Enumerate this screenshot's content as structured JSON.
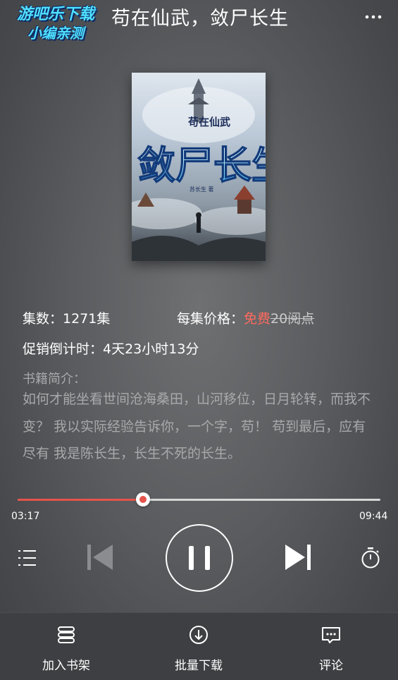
{
  "watermark": {
    "line1": "游吧乐下载",
    "line2": "小编亲测"
  },
  "header": {
    "title": "苟在仙武，敛尸长生"
  },
  "cover": {
    "small_title": "苟在仙武",
    "big_title": "敛尸长生",
    "author": "苏长生 著"
  },
  "info": {
    "episodes_label": "集数：1271集",
    "price_label": "每集价格：",
    "price_free": "免费",
    "price_old": "20阅点",
    "countdown": "促销倒计时：4天23小时13分"
  },
  "intro": {
    "label": "书籍简介：",
    "text": "如何才能坐看世间沧海桑田，山河移位，日月轮转，而我不变？ 我以实际经验告诉你，一个字，苟！ 苟到最后，应有尽有 我是陈长生，长生不死的长生。"
  },
  "player": {
    "current": "03:17",
    "total": "09:44",
    "progress": 0.346
  },
  "bottom": {
    "shelf": "加入书架",
    "download": "批量下载",
    "comment": "评论"
  },
  "colors": {
    "accent": "#e5534b",
    "free": "#ff6a5e"
  }
}
